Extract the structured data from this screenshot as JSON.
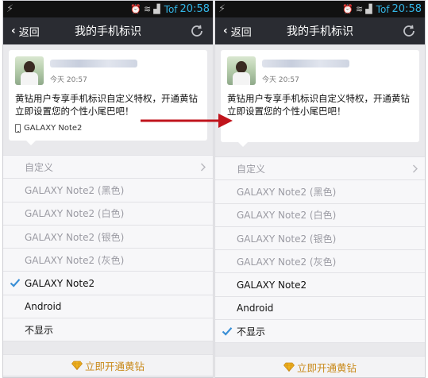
{
  "screens": [
    {
      "status": {
        "brand": "Tof",
        "time": "20:58"
      },
      "header": {
        "back_label": "返回",
        "title": "我的手机标识"
      },
      "post": {
        "time": "今天 20:57",
        "text": "黄钻用户专享手机标识自定义特权，开通黄钻立即设置您的个性小尾巴吧！",
        "device": "GALAXY Note2"
      },
      "options": [
        {
          "label": "自定义",
          "selected": false,
          "active": false,
          "has_chevron": true
        },
        {
          "label": "GALAXY Note2 (黑色)",
          "selected": false,
          "active": false,
          "has_chevron": false
        },
        {
          "label": "GALAXY Note2 (白色)",
          "selected": false,
          "active": false,
          "has_chevron": false
        },
        {
          "label": "GALAXY Note2 (银色)",
          "selected": false,
          "active": false,
          "has_chevron": false
        },
        {
          "label": "GALAXY Note2 (灰色)",
          "selected": false,
          "active": false,
          "has_chevron": false
        },
        {
          "label": "GALAXY Note2",
          "selected": true,
          "active": true,
          "has_chevron": false
        },
        {
          "label": "Android",
          "selected": false,
          "active": true,
          "has_chevron": false
        },
        {
          "label": "不显示",
          "selected": false,
          "active": true,
          "has_chevron": false
        }
      ],
      "cta_label": "立即开通黄钻"
    },
    {
      "status": {
        "brand": "Tof",
        "time": "20:58"
      },
      "header": {
        "back_label": "返回",
        "title": "我的手机标识"
      },
      "post": {
        "time": "今天 20:57",
        "text": "黄钻用户专享手机标识自定义特权，开通黄钻立即设置您的个性小尾巴吧！",
        "device": ""
      },
      "options": [
        {
          "label": "自定义",
          "selected": false,
          "active": false,
          "has_chevron": true
        },
        {
          "label": "GALAXY Note2 (黑色)",
          "selected": false,
          "active": false,
          "has_chevron": false
        },
        {
          "label": "GALAXY Note2 (白色)",
          "selected": false,
          "active": false,
          "has_chevron": false
        },
        {
          "label": "GALAXY Note2 (银色)",
          "selected": false,
          "active": false,
          "has_chevron": false
        },
        {
          "label": "GALAXY Note2 (灰色)",
          "selected": false,
          "active": false,
          "has_chevron": false
        },
        {
          "label": "GALAXY Note2",
          "selected": false,
          "active": true,
          "has_chevron": false
        },
        {
          "label": "Android",
          "selected": false,
          "active": true,
          "has_chevron": false
        },
        {
          "label": "不显示",
          "selected": true,
          "active": true,
          "has_chevron": false
        }
      ],
      "cta_label": "立即开通黄钻"
    }
  ],
  "colors": {
    "accent_check": "#3a8fd6",
    "cta_text": "#c98a1a",
    "arrow": "#c0141c",
    "titlebar": "#2a2c32"
  },
  "icons": [
    "bolt-icon",
    "back-chevron-icon",
    "refresh-icon",
    "check-icon",
    "chevron-right-icon",
    "diamond-icon",
    "phone-icon",
    "arrow-right-icon"
  ]
}
